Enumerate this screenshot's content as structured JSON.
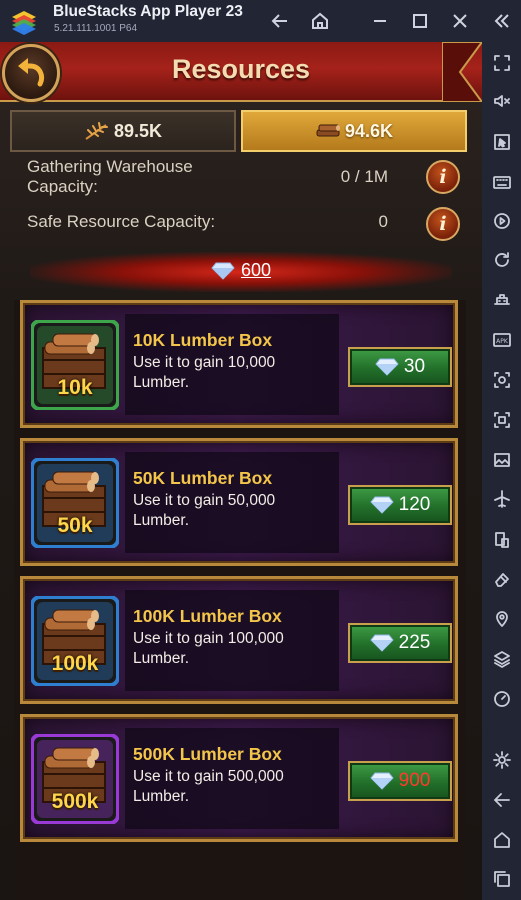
{
  "app": {
    "title": "BlueStacks App Player 23",
    "version": "5.21.111.1001  P64"
  },
  "header": {
    "title": "Resources"
  },
  "tabs": [
    {
      "label": "89.5K",
      "icon": "wheat-icon",
      "selected": false
    },
    {
      "label": "94.6K",
      "icon": "lumber-icon",
      "selected": true
    }
  ],
  "capacity": {
    "warehouse_label": "Gathering Warehouse Capacity:",
    "warehouse_value": "0 / 1M",
    "safe_label": "Safe Resource Capacity:",
    "safe_value": "0"
  },
  "gems": {
    "balance": "600"
  },
  "items": [
    {
      "name": "10K Lumber Box",
      "desc": "Use it to gain 10,000 Lumber.",
      "level_label": "10k",
      "price": "30",
      "rarity": "green",
      "affordable": true
    },
    {
      "name": "50K Lumber Box",
      "desc": "Use it to gain 50,000 Lumber.",
      "level_label": "50k",
      "price": "120",
      "rarity": "blue",
      "affordable": true
    },
    {
      "name": "100K Lumber Box",
      "desc": "Use it to gain 100,000 Lumber.",
      "level_label": "100k",
      "price": "225",
      "rarity": "blue",
      "affordable": true
    },
    {
      "name": "500K Lumber Box",
      "desc": "Use it to gain 500,000 Lumber.",
      "level_label": "500k",
      "price": "900",
      "rarity": "purple",
      "affordable": false
    }
  ],
  "colors": {
    "accent_gold": "#c89a4a",
    "header_red": "#a5221a",
    "buy_green": "#2e8a36",
    "price_red": "#ff3b2b",
    "rarity_green": "#3da64a",
    "rarity_blue": "#2f7fd0",
    "rarity_purple": "#9a3ad6"
  }
}
